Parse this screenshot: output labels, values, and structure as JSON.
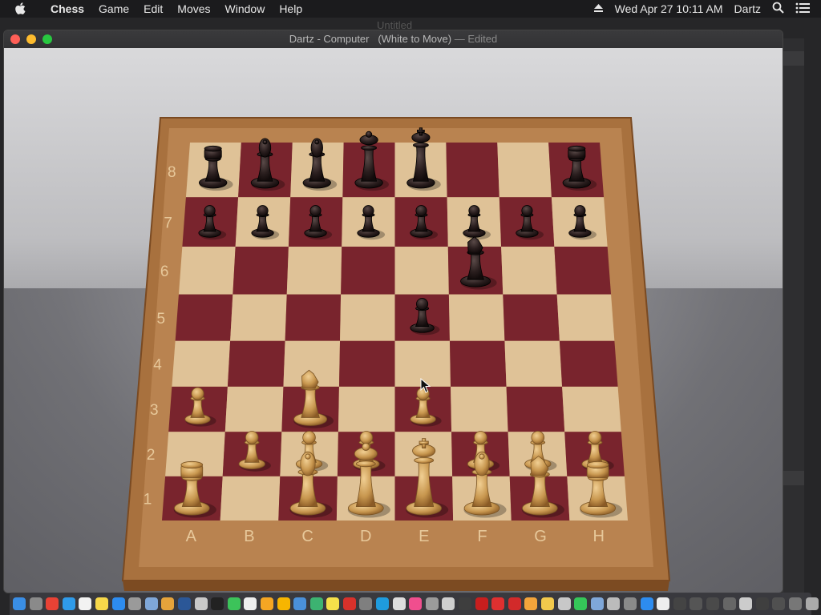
{
  "menubar": {
    "app_name": "Chess",
    "items": [
      "Game",
      "Edit",
      "Moves",
      "Window",
      "Help"
    ],
    "clock": "Wed Apr 27  10:11 AM",
    "user": "Dartz"
  },
  "background_window": {
    "title": "Untitled"
  },
  "window": {
    "title_main": "Dartz - Computer   (White to Move)",
    "title_edited": "— Edited"
  },
  "board": {
    "files": [
      "A",
      "B",
      "C",
      "D",
      "E",
      "F",
      "G",
      "H"
    ],
    "ranks": [
      "8",
      "7",
      "6",
      "5",
      "4",
      "3",
      "2",
      "1"
    ],
    "light_square_color": "#d8b98a",
    "dark_square_color": "#8a2a34",
    "frame_color": "#a8713e",
    "pieces": [
      {
        "square": "a8",
        "color": "black",
        "type": "rook"
      },
      {
        "square": "b8",
        "color": "black",
        "type": "bishop"
      },
      {
        "square": "c8",
        "color": "black",
        "type": "bishop"
      },
      {
        "square": "d8",
        "color": "black",
        "type": "queen"
      },
      {
        "square": "e8",
        "color": "black",
        "type": "king"
      },
      {
        "square": "h8",
        "color": "black",
        "type": "rook"
      },
      {
        "square": "a7",
        "color": "black",
        "type": "pawn"
      },
      {
        "square": "b7",
        "color": "black",
        "type": "pawn"
      },
      {
        "square": "c7",
        "color": "black",
        "type": "pawn"
      },
      {
        "square": "d7",
        "color": "black",
        "type": "pawn"
      },
      {
        "square": "e7",
        "color": "black",
        "type": "pawn"
      },
      {
        "square": "f7",
        "color": "black",
        "type": "pawn"
      },
      {
        "square": "g7",
        "color": "black",
        "type": "pawn"
      },
      {
        "square": "h7",
        "color": "black",
        "type": "pawn"
      },
      {
        "square": "f6",
        "color": "black",
        "type": "knight"
      },
      {
        "square": "e5",
        "color": "black",
        "type": "pawn"
      },
      {
        "square": "a3",
        "color": "white",
        "type": "pawn"
      },
      {
        "square": "c3",
        "color": "white",
        "type": "knight"
      },
      {
        "square": "e3",
        "color": "white",
        "type": "pawn"
      },
      {
        "square": "b2",
        "color": "white",
        "type": "pawn"
      },
      {
        "square": "c2",
        "color": "white",
        "type": "pawn"
      },
      {
        "square": "d2",
        "color": "white",
        "type": "pawn"
      },
      {
        "square": "f2",
        "color": "white",
        "type": "pawn"
      },
      {
        "square": "g2",
        "color": "white",
        "type": "pawn"
      },
      {
        "square": "h2",
        "color": "white",
        "type": "pawn"
      },
      {
        "square": "a1",
        "color": "white",
        "type": "rook"
      },
      {
        "square": "c1",
        "color": "white",
        "type": "bishop"
      },
      {
        "square": "d1",
        "color": "white",
        "type": "queen"
      },
      {
        "square": "e1",
        "color": "white",
        "type": "king"
      },
      {
        "square": "f1",
        "color": "white",
        "type": "bishop"
      },
      {
        "square": "g1",
        "color": "white",
        "type": "knight"
      },
      {
        "square": "h1",
        "color": "white",
        "type": "rook"
      }
    ]
  },
  "dock": {
    "icons": [
      {
        "name": "finder-icon",
        "color": "#3a8ee6"
      },
      {
        "name": "launchpad-icon",
        "color": "#8a8a8a"
      },
      {
        "name": "chrome-icon",
        "color": "#e94235"
      },
      {
        "name": "safari-icon",
        "color": "#2f9bea"
      },
      {
        "name": "calendar-icon",
        "color": "#f2f2f2"
      },
      {
        "name": "notes-icon",
        "color": "#f7d84a"
      },
      {
        "name": "app-store-icon",
        "color": "#2d8cf0"
      },
      {
        "name": "system-preferences-icon",
        "color": "#9a9a9a"
      },
      {
        "name": "preview-icon",
        "color": "#7fa7d9"
      },
      {
        "name": "books-icon",
        "color": "#e5a33b"
      },
      {
        "name": "word-icon",
        "color": "#2b5797"
      },
      {
        "name": "finder-doc-icon",
        "color": "#c9c9c9"
      },
      {
        "name": "terminal-icon",
        "color": "#222222"
      },
      {
        "name": "facetime-icon",
        "color": "#3cc35a"
      },
      {
        "name": "document-icon",
        "color": "#eeeeee"
      },
      {
        "name": "pages-icon",
        "color": "#f5a623"
      },
      {
        "name": "sketch-icon",
        "color": "#f7b500"
      },
      {
        "name": "keynote-icon",
        "color": "#4a90d9"
      },
      {
        "name": "numbers-icon",
        "color": "#3cb371"
      },
      {
        "name": "stickies-icon",
        "color": "#f5e04a"
      },
      {
        "name": "acrobat-icon",
        "color": "#d8312b"
      },
      {
        "name": "calculator-icon",
        "color": "#7f7f7f"
      },
      {
        "name": "edge-icon",
        "color": "#1f9bde"
      },
      {
        "name": "script-icon",
        "color": "#dddddd"
      },
      {
        "name": "itunes-icon",
        "color": "#f04e8e"
      },
      {
        "name": "automator-icon",
        "color": "#9b9b9b"
      },
      {
        "name": "pdf-icon",
        "color": "#cfcfcf"
      },
      {
        "name": "activity-monitor-icon",
        "color": "#3e3e3e"
      },
      {
        "name": "photo-booth-icon",
        "color": "#c81e1e"
      },
      {
        "name": "no-entry-icon",
        "color": "#e03030"
      },
      {
        "name": "bee-icon",
        "color": "#d22a2a"
      },
      {
        "name": "home-icon",
        "color": "#f3a43b"
      },
      {
        "name": "photos-icon",
        "color": "#f2c94c"
      },
      {
        "name": "puzzle-icon",
        "color": "#c8c8c8"
      },
      {
        "name": "messages-icon",
        "color": "#35c759"
      },
      {
        "name": "plane-icon",
        "color": "#7fa7d9"
      },
      {
        "name": "wand-icon",
        "color": "#bbbbbb"
      },
      {
        "name": "archive-icon",
        "color": "#8a8a8a"
      },
      {
        "name": "app-store-2-icon",
        "color": "#2d8cf0"
      },
      {
        "name": "file-icon",
        "color": "#eeeeee"
      },
      {
        "name": "window-thumb-1-icon",
        "color": "#444444"
      },
      {
        "name": "window-thumb-2-icon",
        "color": "#555555"
      },
      {
        "name": "window-thumb-3-icon",
        "color": "#4a4a4a"
      },
      {
        "name": "window-thumb-4-icon",
        "color": "#666666"
      },
      {
        "name": "window-thumb-5-icon",
        "color": "#cccccc"
      },
      {
        "name": "window-thumb-6-icon",
        "color": "#3f3f3f"
      },
      {
        "name": "window-thumb-7-icon",
        "color": "#505050"
      },
      {
        "name": "window-thumb-8-icon",
        "color": "#777777"
      },
      {
        "name": "trash-icon",
        "color": "#aaaaaa"
      }
    ]
  }
}
